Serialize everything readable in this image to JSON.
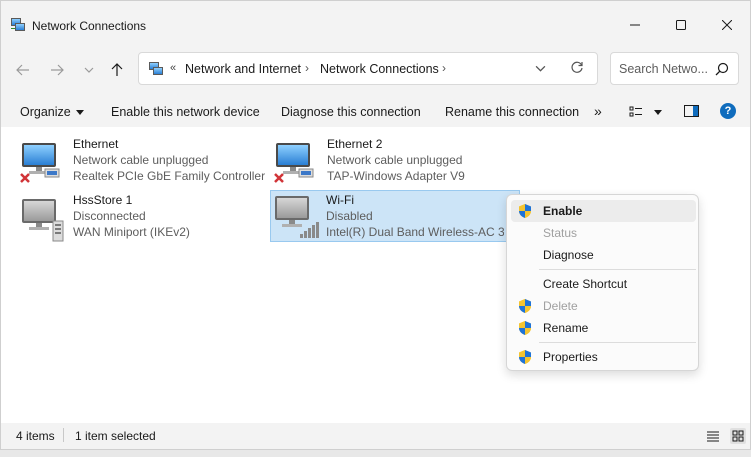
{
  "window": {
    "title": "Network Connections",
    "title_icon": "network-connections-icon"
  },
  "address": {
    "overflow": "«",
    "crumbs": [
      "Network and Internet",
      "Network Connections"
    ],
    "separator": "›"
  },
  "search": {
    "placeholder": "Search Netwo..."
  },
  "commands": {
    "organize": "Organize",
    "enable": "Enable this network device",
    "diagnose": "Diagnose this connection",
    "rename": "Rename this connection",
    "more": "»",
    "help": "?"
  },
  "connections": [
    {
      "name": "Ethernet",
      "status": "Network cable unplugged",
      "device": "Realtek PCIe GbE Family Controller",
      "badge": "red-x"
    },
    {
      "name": "Ethernet 2",
      "status": "Network cable unplugged",
      "device": "TAP-Windows Adapter V9",
      "badge": "red-x"
    },
    {
      "name": "HssStore 1",
      "status": "Disconnected",
      "device": "WAN Miniport (IKEv2)",
      "badge": "none"
    },
    {
      "name": "Wi-Fi",
      "status": "Disabled",
      "device": "Intel(R) Dual Band Wireless-AC 31",
      "badge": "signal"
    }
  ],
  "status_bar": {
    "count": "4 items",
    "selection": "1 item selected"
  },
  "context_menu": {
    "items": [
      {
        "label": "Enable",
        "icon": "uac-shield-icon",
        "bold": true,
        "disabled": false
      },
      {
        "label": "Status",
        "icon": "",
        "bold": false,
        "disabled": true
      },
      {
        "label": "Diagnose",
        "icon": "",
        "bold": false,
        "disabled": false
      },
      {
        "label": "Create Shortcut",
        "icon": "",
        "bold": false,
        "disabled": false
      },
      {
        "label": "Delete",
        "icon": "uac-shield-icon",
        "bold": false,
        "disabled": true
      },
      {
        "label": "Rename",
        "icon": "uac-shield-icon",
        "bold": false,
        "disabled": false
      },
      {
        "label": "Properties",
        "icon": "uac-shield-icon",
        "bold": false,
        "disabled": false
      }
    ]
  },
  "colors": {
    "selection_bg": "#cce4f7",
    "selection_border": "#99c9ef",
    "accent": "#0f6cbd",
    "error_red": "#d13438"
  }
}
